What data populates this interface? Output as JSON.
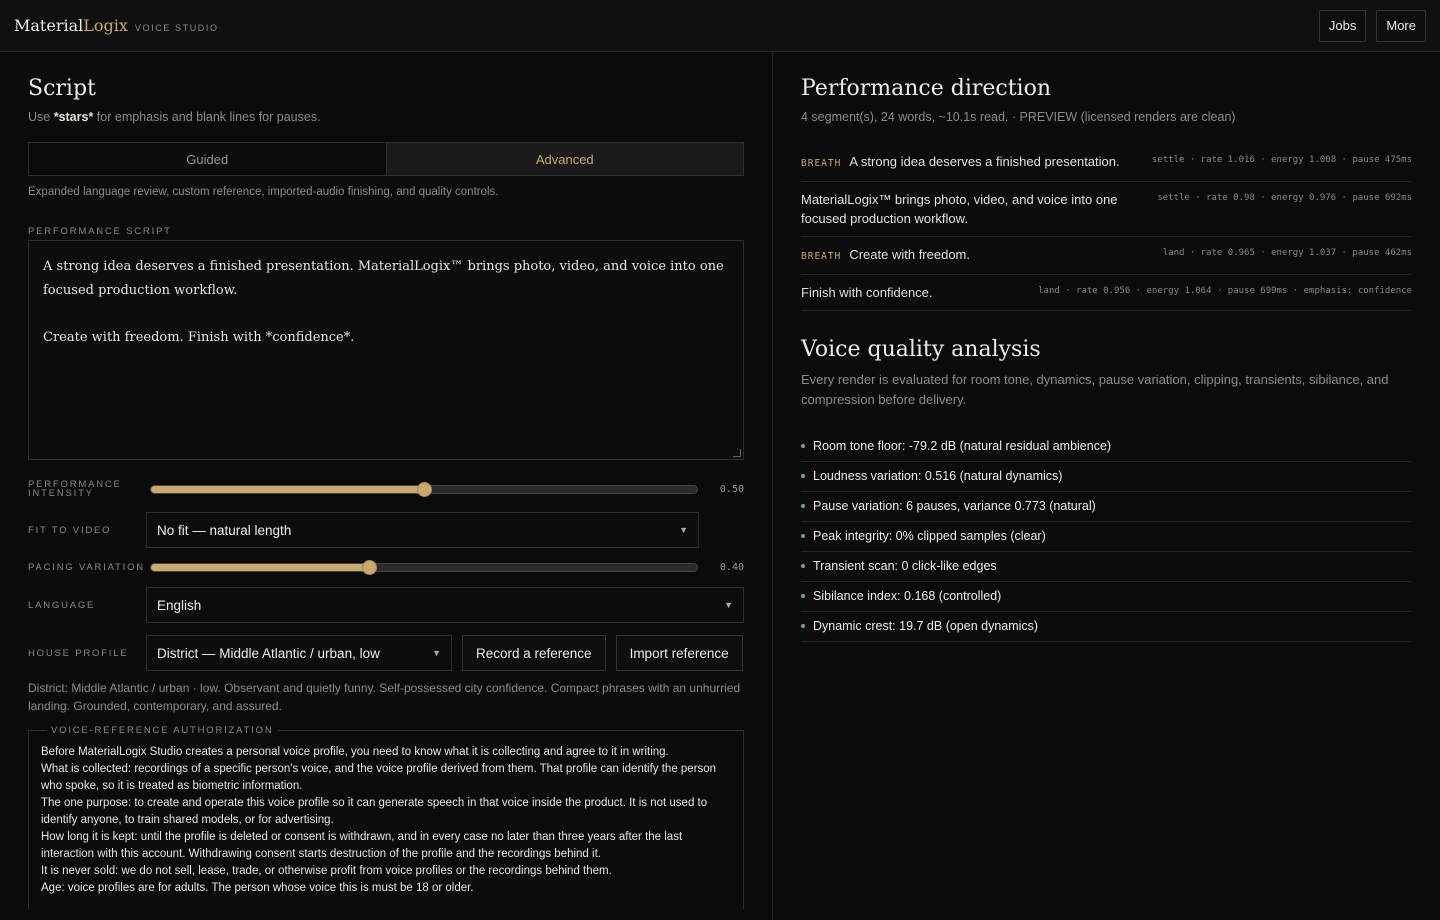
{
  "brand": {
    "main": "Material",
    "accent": "Logix",
    "sub": "VOICE STUDIO"
  },
  "topnav": {
    "jobs": "Jobs",
    "more": "More"
  },
  "script": {
    "title": "Script",
    "hint_prefix": "Use ",
    "hint_bold": "*stars*",
    "hint_suffix": " for emphasis and blank lines for pauses.",
    "modes": [
      "Guided",
      "Advanced"
    ],
    "active_mode": "Advanced",
    "mode_note": "Expanded language review, custom reference, imported-audio finishing, and quality controls.",
    "performance_label": "PERFORMANCE SCRIPT",
    "text_p1": "A strong idea deserves a finished presentation. MaterialLogix™ brings photo, video, and voice into one focused production workflow.",
    "text_p2": "Create with freedom. Finish with *confidence*."
  },
  "controls": {
    "intensity_label": "PERFORMANCE INTENSITY",
    "intensity_value": 0.5,
    "intensity_display": "0.50",
    "fit_label": "FIT TO VIDEO",
    "fit_value": "No fit — natural length",
    "pacing_label": "PACING VARIATION",
    "pacing_value": 0.4,
    "pacing_display": "0.40",
    "language_label": "LANGUAGE",
    "language_value": "English",
    "profile_label": "HOUSE PROFILE",
    "profile_value": "District — Middle Atlantic / urban, low",
    "record_button": "Record a reference",
    "import_button": "Import reference",
    "profile_description": "District: Middle Atlantic / urban · low. Observant and quietly funny. Self-possessed city confidence. Compact phrases with an unhurried landing. Grounded, contemporary, and assured."
  },
  "authorization": {
    "legend": "VOICE-REFERENCE AUTHORIZATION",
    "lines": [
      "Before MaterialLogix Studio creates a personal voice profile, you need to know what it is collecting and agree to it in writing.",
      "What is collected: recordings of a specific person's voice, and the voice profile derived from them. That profile can identify the person who spoke, so it is treated as biometric information.",
      "The one purpose: to create and operate this voice profile so it can generate speech in that voice inside the product. It is not used to identify anyone, to train shared models, or for advertising.",
      "How long it is kept: until the profile is deleted or consent is withdrawn, and in every case no later than three years after the last interaction with this account. Withdrawing consent starts destruction of the profile and the recordings behind it.",
      "It is never sold: we do not sell, lease, trade, or otherwise profit from voice profiles or the recordings behind them.",
      "Age: voice profiles are for adults. The person whose voice this is must be 18 or older."
    ]
  },
  "direction": {
    "title": "Performance direction",
    "summary": "4 segment(s), 24 words, ~10.1s read. · PREVIEW (licensed renders are clean)",
    "segments": [
      {
        "tag": "BREATH",
        "text": "A strong idea deserves a finished presentation.",
        "meta": "settle · rate 1.016 · energy 1.008 · pause 475ms"
      },
      {
        "tag": "",
        "text": "MaterialLogix™ brings photo, video, and voice into one focused production workflow.",
        "meta": "settle · rate 0.98 · energy 0.976 · pause 692ms"
      },
      {
        "tag": "BREATH",
        "text": "Create with freedom.",
        "meta": "land · rate 0.965 · energy 1.037 · pause 462ms"
      },
      {
        "tag": "",
        "text": "Finish with confidence.",
        "meta": "land · rate 0.956 · energy 1.064 · pause 699ms · emphasis: confidence"
      }
    ]
  },
  "quality": {
    "title": "Voice quality analysis",
    "description": "Every render is evaluated for room tone, dynamics, pause variation, clipping, transients, sibilance, and compression before delivery.",
    "items": [
      "Room tone floor: -79.2 dB (natural residual ambience)",
      "Loudness variation: 0.516 (natural dynamics)",
      "Pause variation: 6 pauses, variance 0.773 (natural)",
      "Peak integrity: 0% clipped samples (clear)",
      "Transient scan: 0 click-like edges",
      "Sibilance index: 0.168 (controlled)",
      "Dynamic crest: 19.7 dB (open dynamics)"
    ]
  },
  "colors": {
    "accent": "#c9a96e",
    "ok": "#7aa27a",
    "bg": "#0b0b0b"
  }
}
